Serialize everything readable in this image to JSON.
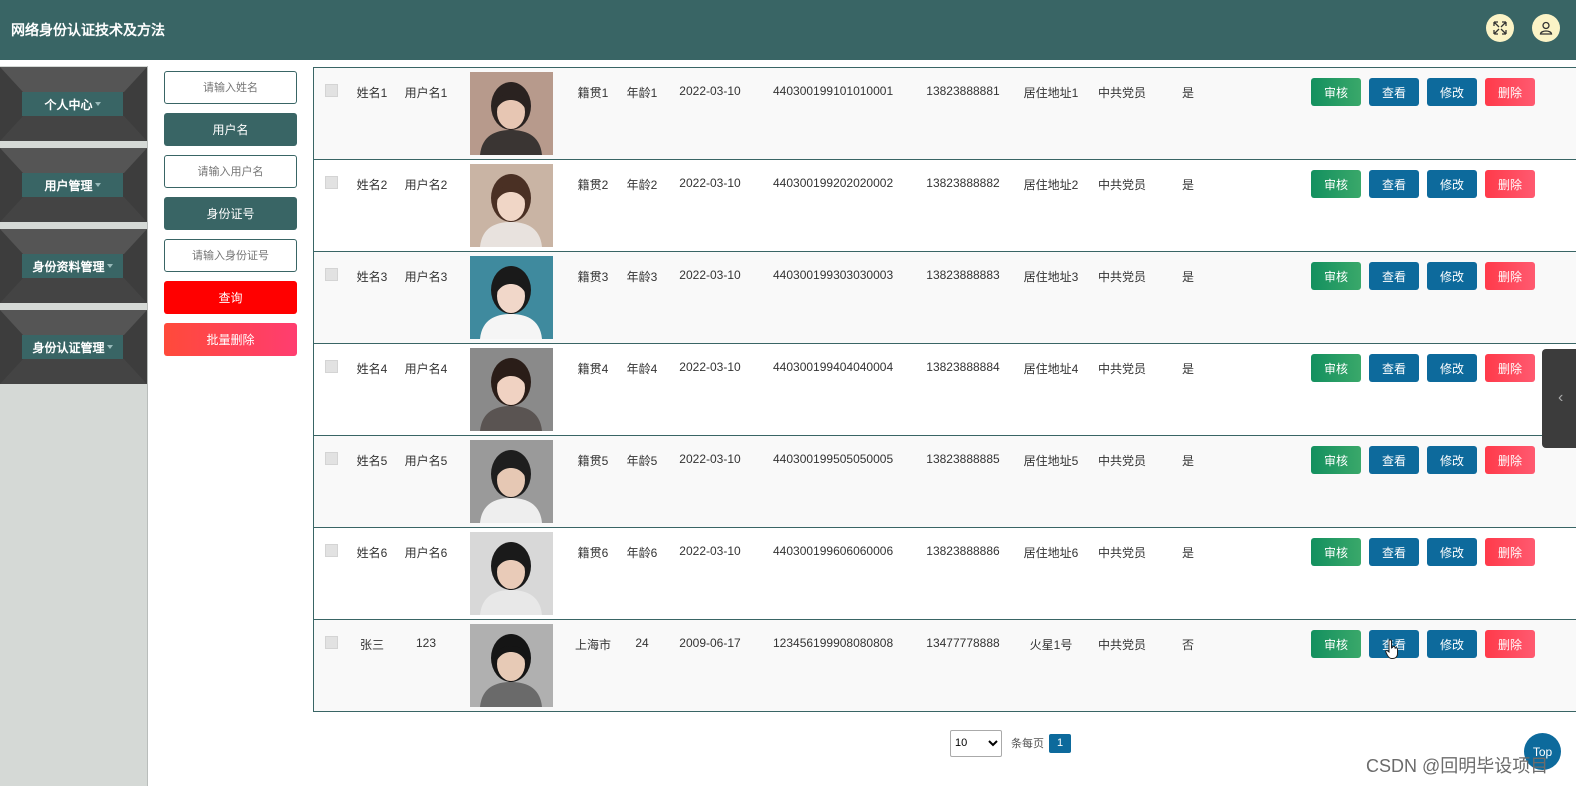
{
  "app": {
    "title": "网络身份认证技术及方法",
    "header_icons": [
      "fullscreen-icon",
      "user-icon"
    ],
    "colors": {
      "primary": "#396565",
      "audit": "#13905f",
      "view_edit": "#0d6a9c",
      "delete": "#ff4458",
      "query": "#ff0000"
    }
  },
  "sidebar": {
    "items": [
      {
        "label": "个人中心"
      },
      {
        "label": "用户管理"
      },
      {
        "label": "身份资料管理"
      },
      {
        "label": "身份认证管理"
      }
    ]
  },
  "search": {
    "name_placeholder": "请输入姓名",
    "username_label": "用户名",
    "username_placeholder": "请输入用户名",
    "idcard_label": "身份证号",
    "idcard_placeholder": "请输入身份证号",
    "query_label": "查询",
    "batch_delete_label": "批量删除"
  },
  "table": {
    "rows": [
      {
        "name": "姓名1",
        "username": "用户名1",
        "native": "籍贯1",
        "age": "年龄1",
        "date": "2022-03-10",
        "idcard": "440300199101010001",
        "phone": "13823888881",
        "address": "居住地址1",
        "party": "中共党员",
        "flag": "是"
      },
      {
        "name": "姓名2",
        "username": "用户名2",
        "native": "籍贯2",
        "age": "年龄2",
        "date": "2022-03-10",
        "idcard": "440300199202020002",
        "phone": "13823888882",
        "address": "居住地址2",
        "party": "中共党员",
        "flag": "是"
      },
      {
        "name": "姓名3",
        "username": "用户名3",
        "native": "籍贯3",
        "age": "年龄3",
        "date": "2022-03-10",
        "idcard": "440300199303030003",
        "phone": "13823888883",
        "address": "居住地址3",
        "party": "中共党员",
        "flag": "是"
      },
      {
        "name": "姓名4",
        "username": "用户名4",
        "native": "籍贯4",
        "age": "年龄4",
        "date": "2022-03-10",
        "idcard": "440300199404040004",
        "phone": "13823888884",
        "address": "居住地址4",
        "party": "中共党员",
        "flag": "是"
      },
      {
        "name": "姓名5",
        "username": "用户名5",
        "native": "籍贯5",
        "age": "年龄5",
        "date": "2022-03-10",
        "idcard": "440300199505050005",
        "phone": "13823888885",
        "address": "居住地址5",
        "party": "中共党员",
        "flag": "是"
      },
      {
        "name": "姓名6",
        "username": "用户名6",
        "native": "籍贯6",
        "age": "年龄6",
        "date": "2022-03-10",
        "idcard": "440300199606060006",
        "phone": "13823888886",
        "address": "居住地址6",
        "party": "中共党员",
        "flag": "是"
      },
      {
        "name": "张三",
        "username": "123",
        "native": "上海市",
        "age": "24",
        "date": "2009-06-17",
        "idcard": "123456199908080808",
        "phone": "13477778888",
        "address": "火星1号",
        "party": "中共党员",
        "flag": "否"
      }
    ],
    "actions": {
      "audit": "审核",
      "view": "查看",
      "edit": "修改",
      "delete": "删除"
    }
  },
  "pagination": {
    "page_size": "10",
    "per_page_label": "条每页",
    "current_page": "1"
  },
  "top_button": "Top",
  "watermark": "CSDN @回明毕设项目"
}
